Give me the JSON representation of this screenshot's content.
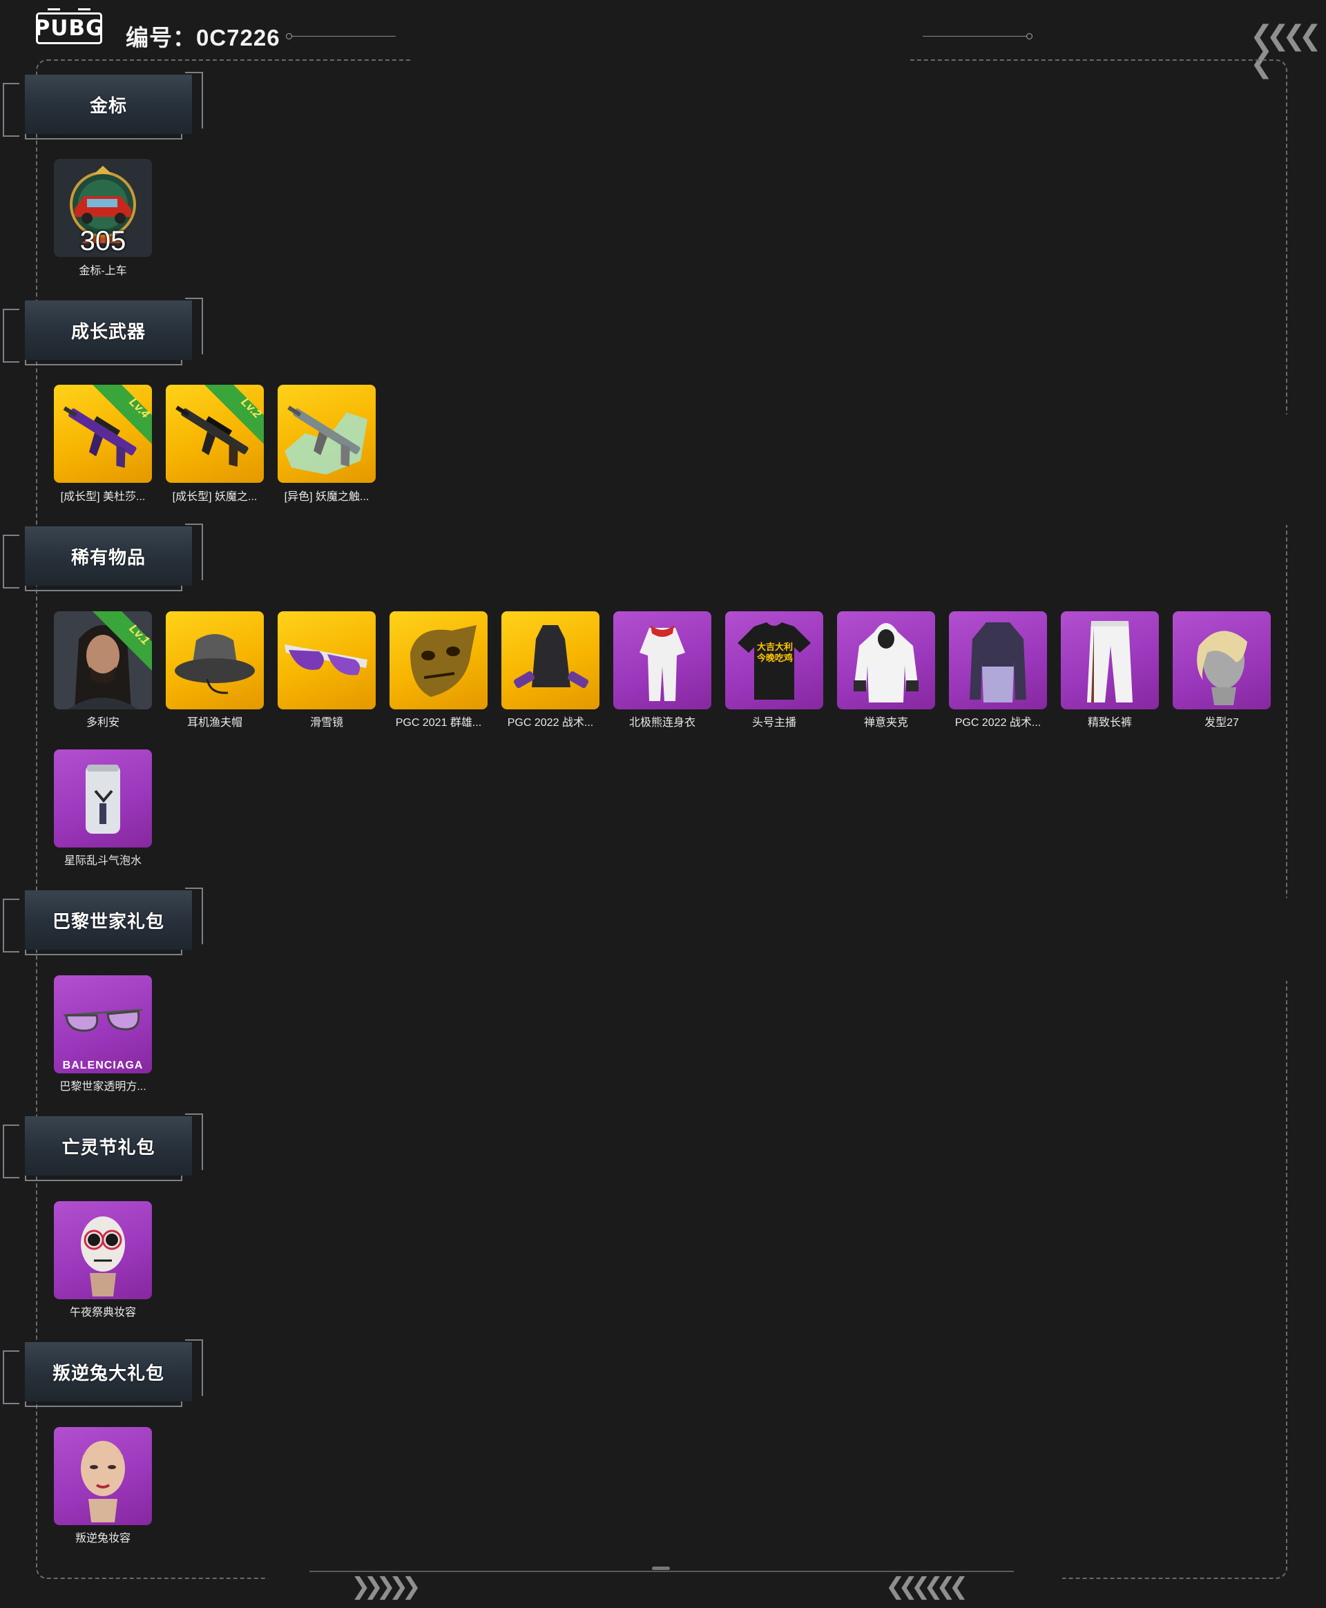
{
  "header": {
    "logo_text": "PUBG",
    "serial": "编号：0C7226"
  },
  "sections": [
    {
      "title": "金标",
      "items": [
        {
          "name": "金标-上车",
          "value": "305"
        }
      ]
    },
    {
      "title": "成长武器",
      "items": [
        {
          "name": "[成长型] 美杜莎...",
          "level": "Lv.4"
        },
        {
          "name": "[成长型] 妖魔之...",
          "level": "Lv.2"
        },
        {
          "name": "[异色] 妖魔之触..."
        }
      ]
    },
    {
      "title": "稀有物品",
      "items": [
        {
          "name": "多利安",
          "level": "Lv.1"
        },
        {
          "name": "耳机渔夫帽"
        },
        {
          "name": "滑雪镜"
        },
        {
          "name": "PGC 2021 群雄..."
        },
        {
          "name": "PGC 2022 战术..."
        },
        {
          "name": "北极熊连身衣"
        },
        {
          "name": "头号主播",
          "shirt_text": "大吉大利今晚吃鸡"
        },
        {
          "name": "禅意夹克"
        },
        {
          "name": "PGC 2022 战术..."
        },
        {
          "name": "精致长裤"
        },
        {
          "name": "发型27"
        },
        {
          "name": "星际乱斗气泡水"
        }
      ]
    },
    {
      "title": "巴黎世家礼包",
      "items": [
        {
          "name": "巴黎世家透明方...",
          "brand": "BALENCIAGA"
        }
      ]
    },
    {
      "title": "亡灵节礼包",
      "items": [
        {
          "name": "午夜祭典妆容"
        }
      ]
    },
    {
      "title": "叛逆兔大礼包",
      "items": [
        {
          "name": "叛逆兔妆容"
        }
      ]
    }
  ],
  "colors": {
    "background": "#1b1b1b",
    "gold": "#f7b400",
    "purple": "#9a36ba",
    "level_badge": "#3aa53a"
  }
}
